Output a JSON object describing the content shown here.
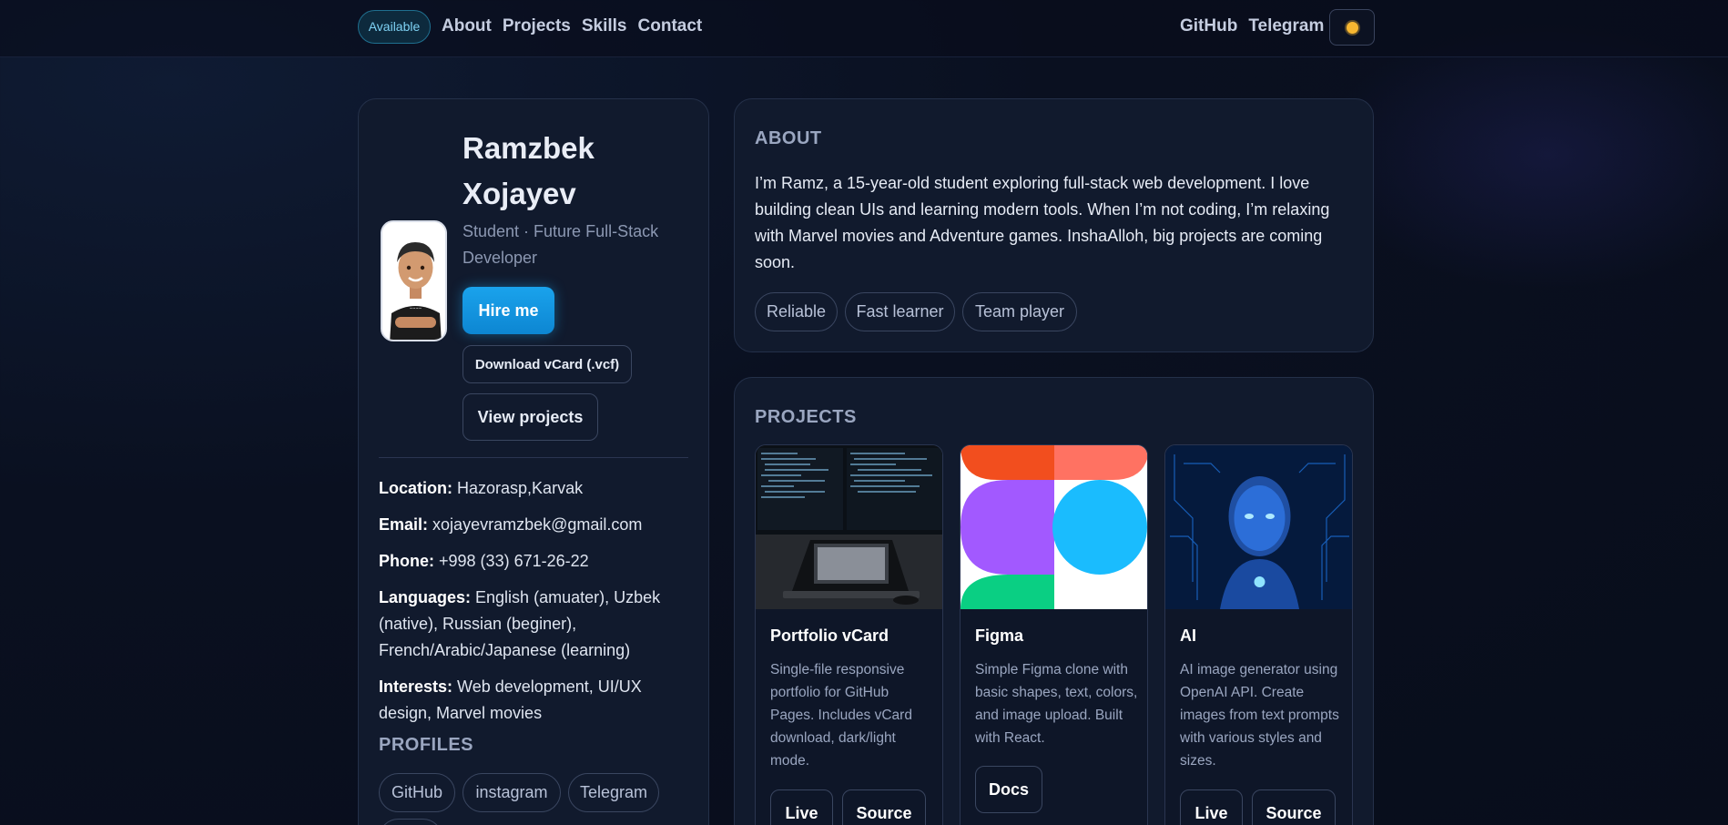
{
  "nav": {
    "badge": "Available",
    "links": [
      "About",
      "Projects",
      "Skills",
      "Contact"
    ],
    "right_links": [
      "GitHub",
      "Telegram"
    ],
    "theme_icon": "sun-icon"
  },
  "profile": {
    "name": "Ramzbek Xojayev",
    "role": "Student · Future Full-Stack Developer",
    "hire_label": "Hire me",
    "vcard_label": "Download vCard (.vcf)",
    "view_projects_label": "View projects",
    "location_label": "Location:",
    "location": "Hazorasp,Karvak",
    "email_label": "Email:",
    "email": "xojayevramzbek@gmail.com",
    "phone_label": "Phone:",
    "phone": "+998 (33) 671-26-22",
    "languages_label": "Languages:",
    "languages": "English (amuater), Uzbek (native), Russian (beginer), French/Arabic/Japanese (learning)",
    "interests_label": "Interests:",
    "interests": "Web development, UI/UX design, Marvel movies",
    "profiles_title": "PROFILES",
    "profile_links": [
      "GitHub",
      "instagram",
      "Telegram"
    ]
  },
  "about": {
    "title": "ABOUT",
    "text": "I’m Ramz, a 15-year-old student exploring full-stack web development. I love building clean UIs and learning modern tools. When I’m not coding, I’m relaxing with Marvel movies and Adventure games. InshaAlloh, big projects are coming soon.",
    "tags": [
      "Reliable",
      "Fast learner",
      "Team player"
    ]
  },
  "projects": {
    "title": "PROJECTS",
    "items": [
      {
        "title": "Portfolio vCard",
        "desc": "Single-file responsive portfolio for GitHub Pages. Includes vCard download, dark/light mode.",
        "buttons": [
          "Live",
          "Source"
        ]
      },
      {
        "title": "Figma",
        "desc": "Simple Figma clone with basic shapes, text, colors, and image upload. Built with React.",
        "buttons": [
          "Docs"
        ]
      },
      {
        "title": "AI",
        "desc": "AI image generator using OpenAI API. Create images from text prompts with various styles and sizes.",
        "buttons": [
          "Live",
          "Source"
        ]
      }
    ]
  },
  "colors": {
    "accent": "#1aa3ec",
    "background": "#0a1020",
    "card": "#111a2d",
    "muted": "#9aa6c0"
  }
}
